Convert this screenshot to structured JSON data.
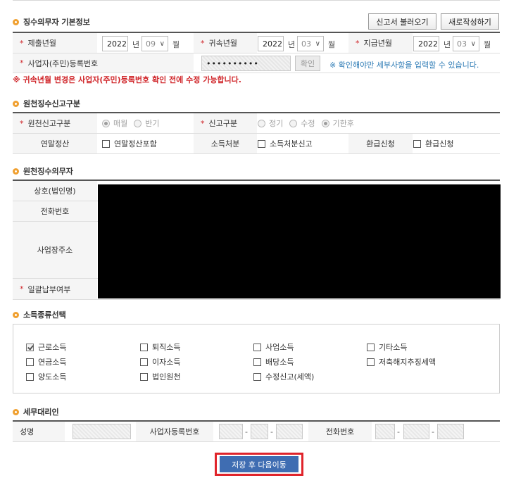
{
  "section1": {
    "title": "징수의무자 기본정보",
    "load_button": "신고서 불러오기",
    "new_button": "새로작성하기",
    "submit_year_label": "제출년월",
    "submit_year": "2022",
    "submit_month": "09",
    "belong_year_label": "귀속년월",
    "belong_year": "2022",
    "belong_month": "03",
    "pay_year_label": "지급년월",
    "pay_year": "2022",
    "pay_month": "03",
    "unit_year": "년",
    "unit_month": "월",
    "regno_label": "사업자(주민)등록번호",
    "regno_value": "••••••••••",
    "confirm_button": "확인",
    "confirm_note": "※ 확인해야만 세부사항을 입력할 수 있습니다.",
    "warning": "※ 귀속년월 변경은 사업자(주민)등록번호 확인 전에 수정 가능합니다."
  },
  "section2": {
    "title": "원천징수신고구분",
    "report_type_label": "원천신고구분",
    "report_type_options": [
      "매월",
      "반기"
    ],
    "report_type_selected": "매월",
    "report_class_label": "신고구분",
    "report_class_options": [
      "정기",
      "수정",
      "기한후"
    ],
    "report_class_selected": "기한후",
    "yearend_label": "연말정산",
    "yearend_check": "연말정산포함",
    "disposal_label": "소득처분",
    "disposal_check": "소득처분신고",
    "refund_label": "환급신청",
    "refund_check": "환급신청"
  },
  "section3": {
    "title": "원천징수의무자",
    "company_label": "상호(법인명)",
    "phone_label": "전화번호",
    "address_label": "사업장주소",
    "batch_label": "일괄납부여부"
  },
  "section4": {
    "title": "소득종류선택",
    "items": [
      {
        "label": "근로소득",
        "checked": true
      },
      {
        "label": "퇴직소득",
        "checked": false
      },
      {
        "label": "사업소득",
        "checked": false
      },
      {
        "label": "기타소득",
        "checked": false
      },
      {
        "label": "연금소득",
        "checked": false
      },
      {
        "label": "이자소득",
        "checked": false
      },
      {
        "label": "배당소득",
        "checked": false
      },
      {
        "label": "저축해지추징세액",
        "checked": false
      },
      {
        "label": "양도소득",
        "checked": false
      },
      {
        "label": "법인원천",
        "checked": false
      },
      {
        "label": "수정신고(세액)",
        "checked": false
      }
    ]
  },
  "section5": {
    "title": "세무대리인",
    "name_label": "성명",
    "bizno_label": "사업자등록번호",
    "phone_label": "전화번호",
    "dash": "-"
  },
  "save_button": "저장 후 다음이동",
  "colors": {
    "accent_blue": "#3f6db2",
    "warning_red": "#d0262a",
    "info_blue": "#2d7bb5",
    "bullet_orange": "#f0a030",
    "highlight_border": "#e0242b"
  }
}
